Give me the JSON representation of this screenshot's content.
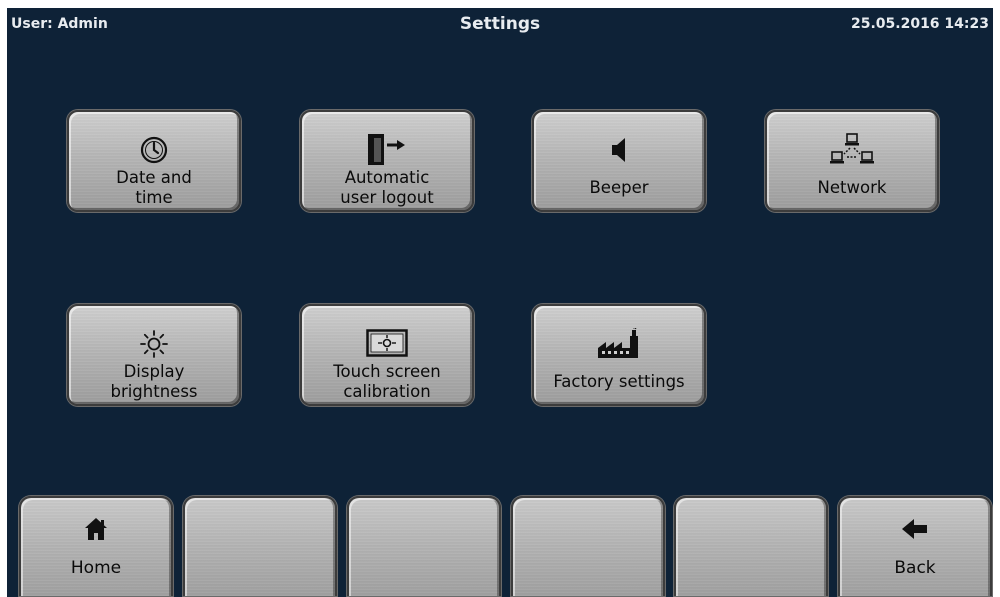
{
  "header": {
    "user": "User: Admin",
    "title": "Settings",
    "datetime": "25.05.2016  14:23"
  },
  "tiles": [
    {
      "label_lines": [
        "Date and",
        "time"
      ],
      "icon": "clock-icon"
    },
    {
      "label_lines": [
        "Automatic",
        "user logout"
      ],
      "icon": "logout-door-icon"
    },
    {
      "label_lines": [
        "Beeper"
      ],
      "icon": "speaker-icon"
    },
    {
      "label_lines": [
        "Network"
      ],
      "icon": "network-icon"
    },
    {
      "label_lines": [
        "Display",
        "brightness"
      ],
      "icon": "sun-icon"
    },
    {
      "label_lines": [
        "Touch screen",
        "calibration"
      ],
      "icon": "calibration-target-icon"
    },
    {
      "label_lines": [
        "Factory settings"
      ],
      "icon": "factory-icon"
    }
  ],
  "nav": {
    "home_label": "Home",
    "back_label": "Back"
  },
  "colors": {
    "background": "#0e2237",
    "button_face": "#b5b5b5",
    "header_text": "#e8ecf0"
  }
}
